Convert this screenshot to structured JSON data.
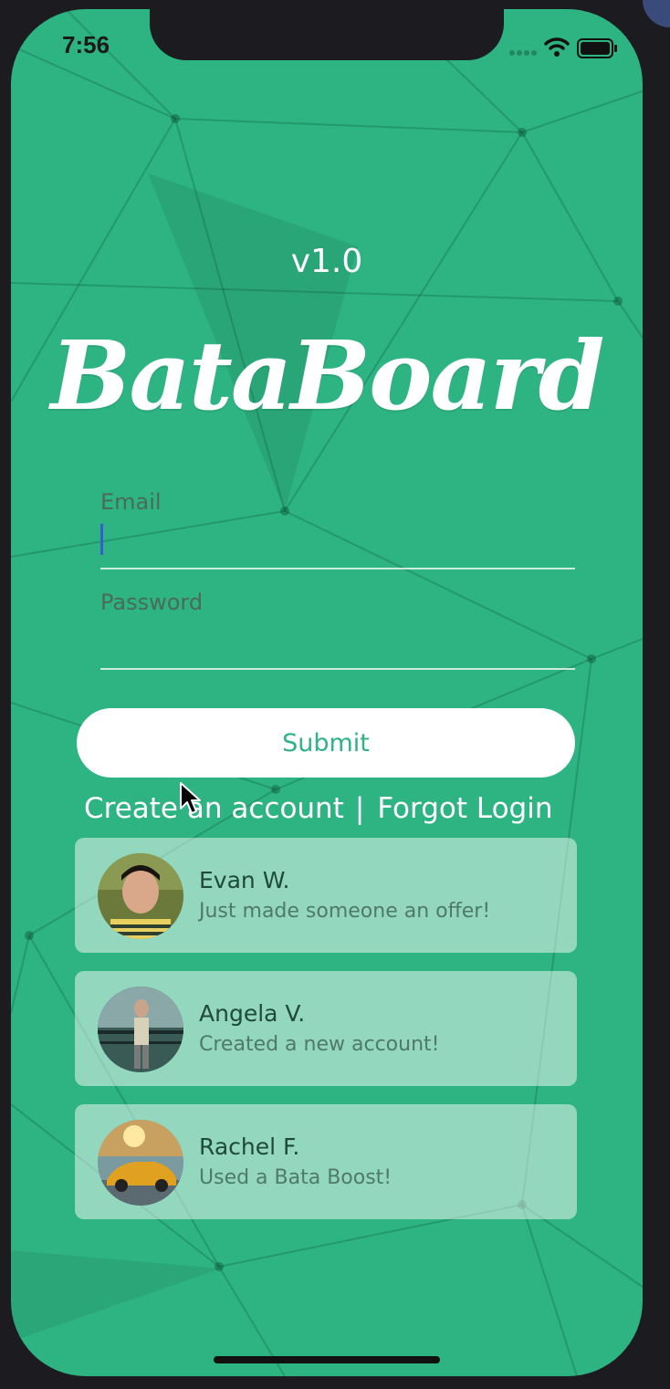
{
  "status_bar": {
    "time": "7:56"
  },
  "app": {
    "version": "v1.0",
    "logo_text": "BataBoard"
  },
  "form": {
    "email_label": "Email",
    "email_value": "",
    "password_label": "Password",
    "password_value": "",
    "submit_label": "Submit"
  },
  "links": {
    "create_account": "Create an account",
    "separator": "|",
    "forgot_login": "Forgot Login"
  },
  "activity": [
    {
      "name": "Evan W.",
      "message": "Just made someone an offer!"
    },
    {
      "name": "Angela V.",
      "message": "Created a new account!"
    },
    {
      "name": "Rachel F.",
      "message": "Used a Bata Boost!"
    }
  ],
  "colors": {
    "background": "#2eb383",
    "accent": "#2eb383",
    "text_light": "#ffffff"
  },
  "icons": [
    "signal-icon",
    "wifi-icon",
    "battery-icon",
    "mouse-cursor-icon"
  ]
}
